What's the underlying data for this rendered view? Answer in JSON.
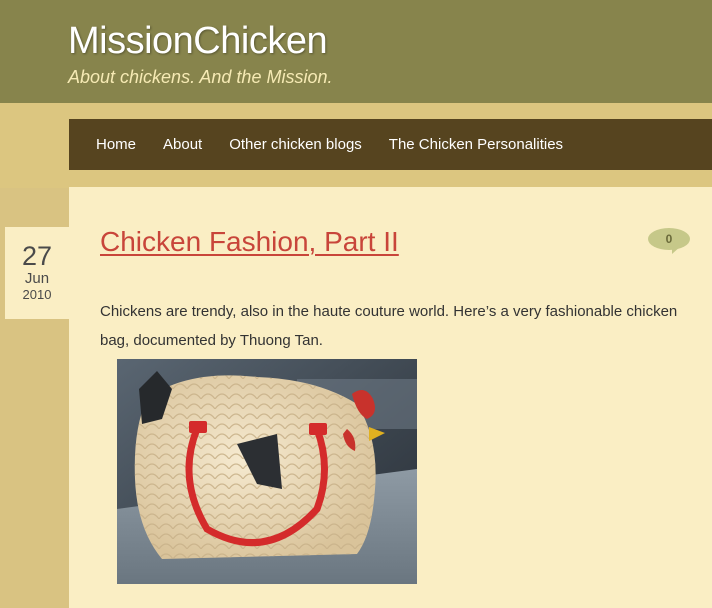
{
  "site": {
    "title": "MissionChicken",
    "tagline": "About chickens. And the Mission."
  },
  "nav": {
    "items": [
      {
        "label": "Home"
      },
      {
        "label": "About"
      },
      {
        "label": "Other chicken blogs"
      },
      {
        "label": "The Chicken Personalities"
      }
    ]
  },
  "post": {
    "date": {
      "day": "27",
      "month": "Jun",
      "year": "2010"
    },
    "title": "Chicken Fashion, Part II",
    "comment_count": "0",
    "body": "Chickens are trendy, also in the haute couture world. Here’s a very fashionable chicken bag, documented by Thuong Tan."
  },
  "colors": {
    "header_bg": "#87844c",
    "nav_bg": "#56441f",
    "content_bg": "#faeec4",
    "title_red": "#c8453a",
    "page_bg": "#d9c382"
  }
}
